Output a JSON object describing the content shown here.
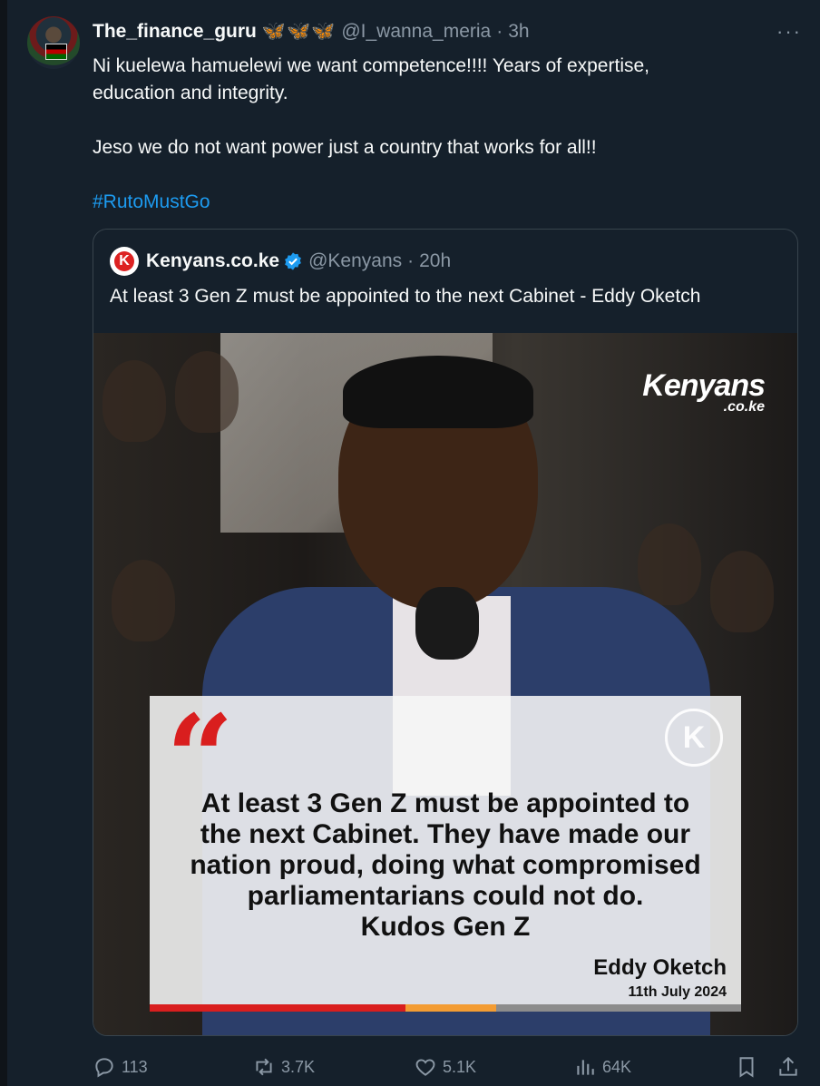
{
  "tweet": {
    "display_name": "The_finance_guru",
    "name_emoji": "🦋🦋🦋",
    "handle": "@I_wanna_meria",
    "separator": "·",
    "time": "3h",
    "more_icon": "···",
    "lines": [
      "Ni kuelewa hamuelewi we want competence!!!! Years of expertise,",
      "education and integrity.",
      "Jeso we do not want power just a country that works for all!!"
    ],
    "hashtag": "#RutoMustGo"
  },
  "quoted": {
    "logo_letter": "K",
    "name": "Kenyans.co.ke",
    "handle": "@Kenyans",
    "separator": "·",
    "time": "20h",
    "text": "At least 3 Gen Z must be appointed to the next Cabinet - Eddy Oketch",
    "image": {
      "brand_line1": "Kenyans",
      "brand_line2": ".co.ke",
      "quote_mark": "“",
      "card_logo": "K",
      "quote_lines": [
        "At least 3 Gen Z must be appointed to",
        "the next Cabinet. They have made our",
        "nation proud, doing what compromised",
        "parliamentarians could not do.",
        "Kudos Gen Z"
      ],
      "author": "Eddy Oketch",
      "date": "11th July 2024"
    }
  },
  "actions": {
    "replies": "113",
    "reposts": "3.7K",
    "likes": "5.1K",
    "views": "64K"
  },
  "colors": {
    "background": "#15202b",
    "text": "#f7f9f9",
    "secondary": "#8b98a5",
    "accent": "#1d9bf0",
    "border": "#38444d"
  }
}
